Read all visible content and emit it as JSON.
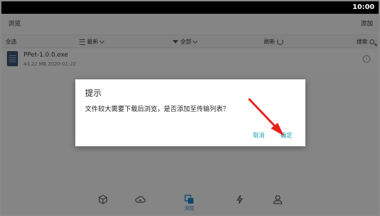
{
  "status_bar": {
    "time": "10:00"
  },
  "header": {
    "title": "浏览",
    "add_label": "添加"
  },
  "toolbar": {
    "select_all": "全选",
    "sort_label": "最新",
    "filter_label": "全部",
    "refresh_label": "刷新",
    "search_label": "搜索"
  },
  "files": [
    {
      "name": "PPet-1.0.0.exe",
      "meta": "43.22 MB 2020-01-22"
    }
  ],
  "bottom_nav": {
    "items": [
      {
        "icon": "cube-icon"
      },
      {
        "icon": "cloud-icon"
      },
      {
        "icon": "browse-icon",
        "label": "浏览",
        "active": true
      },
      {
        "icon": "flash-icon"
      },
      {
        "icon": "person-icon"
      }
    ]
  },
  "dialog": {
    "title": "提示",
    "message": "文件较大需要下载后浏览，是否添加至传输列表？",
    "cancel_label": "取消",
    "confirm_label": "确定"
  },
  "colors": {
    "accent": "#11a0a8",
    "nav_active": "#1e88c9",
    "annotation_arrow": "#e8201c"
  }
}
